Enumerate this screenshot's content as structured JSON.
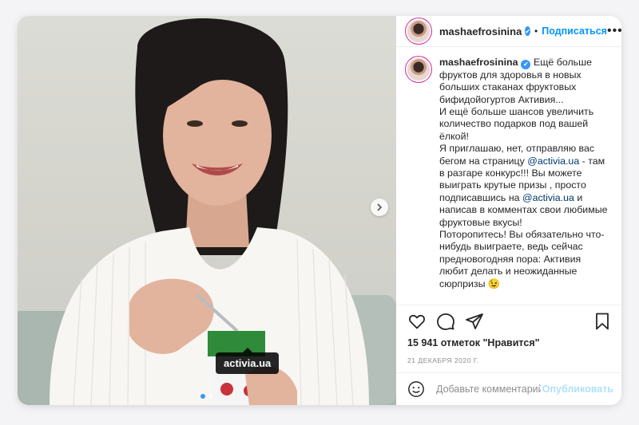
{
  "post": {
    "username": "mashaefrosinina",
    "verified_badge": "✔",
    "separator": "•",
    "follow_label": "Подписаться",
    "more_icon": "•••",
    "tag_label": "activia.ua",
    "image_count": 2,
    "active_image": 1
  },
  "caption": {
    "username": "mashaefrosinina",
    "line1": "Ещё больше фруктов для здоровья в новых больших стаканах фруктовых бифидойогуртов Активия...",
    "line2": "И ещё больше шансов увеличить количество подарков под вашей ёлкой!",
    "line3_a": "Я приглашаю, нет, отправляю вас бегом на страницу ",
    "mention1": "@activia.ua",
    "line3_b": " - там в разгаре конкурс!!! Вы можете выиграть крутые призы , просто подписавшись на ",
    "mention2": "@activia.ua",
    "line3_c": " и написав в комментах свои любимые фруктовые вкусы!",
    "line4": "Поторопитесь! Вы обязательно что-нибудь выиграете, ведь сейчас предновогодняя пора: Активия любит делать и неожиданные сюрпризы 😉"
  },
  "stats": {
    "likes": "15 941 отметок \"Нравится\"",
    "date": "21 ДЕКАБРЯ 2020 Г."
  },
  "comment": {
    "placeholder": "Добавьте комментарий...",
    "post_label": "Опубликовать"
  },
  "icons": {
    "like": "heart-icon",
    "comment": "comment-icon",
    "share": "paper-plane-icon",
    "save": "bookmark-icon",
    "emoji": "smiley-icon",
    "next": "chevron-right-icon"
  },
  "colors": {
    "link": "#0095f6",
    "mention": "#00376b",
    "post_disabled": "#b2dffc",
    "secondary_text": "#8e8e8e"
  }
}
